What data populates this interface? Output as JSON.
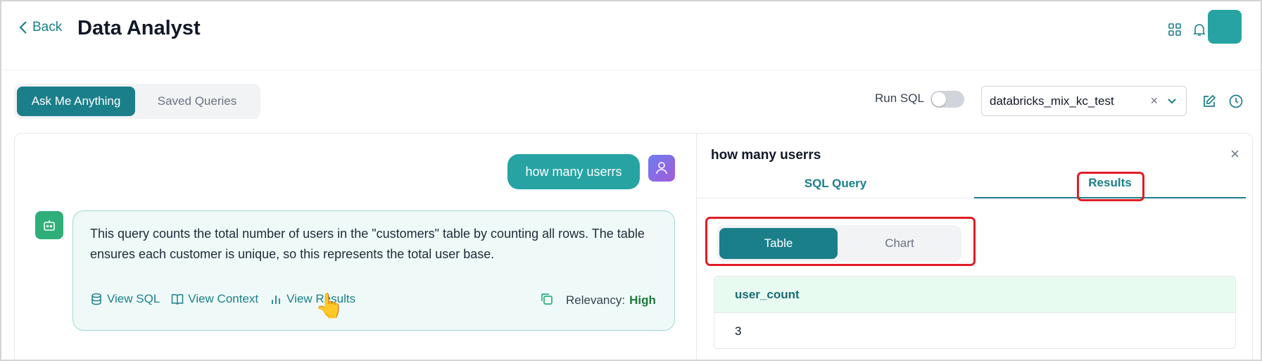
{
  "header": {
    "back_label": "Back",
    "title": "Data Analyst",
    "icons": [
      "grid-icon",
      "bell-icon"
    ]
  },
  "toolbar": {
    "tabs": [
      {
        "label": "Ask Me Anything",
        "active": true
      },
      {
        "label": "Saved Queries",
        "active": false
      }
    ],
    "run_sql_label": "Run SQL",
    "run_sql_enabled": false,
    "datasource": "databricks_mix_kc_test",
    "clear_glyph": "×"
  },
  "chat": {
    "user_message": "how many userrs",
    "bot_message": "This query counts the total number of users in the \"customers\" table by counting all rows. The table ensures each customer is unique, so this represents the total user base.",
    "actions": {
      "view_sql": "View SQL",
      "view_context": "View Context",
      "view_results": "View Results"
    },
    "relevancy_label": "Relevancy:",
    "relevancy_value": "High"
  },
  "results_panel": {
    "title": "how many userrs",
    "close_glyph": "×",
    "tabs": {
      "sql": "SQL Query",
      "results": "Results"
    },
    "active_tab": "Results",
    "view_toggle": {
      "table": "Table",
      "chart": "Chart",
      "active": "Table"
    },
    "table": {
      "columns": [
        "user_count"
      ],
      "rows": [
        [
          "3"
        ]
      ]
    }
  },
  "colors": {
    "accent": "#1b7f8a",
    "highlight": "#e11d24",
    "bubble": "#27a3a3"
  }
}
